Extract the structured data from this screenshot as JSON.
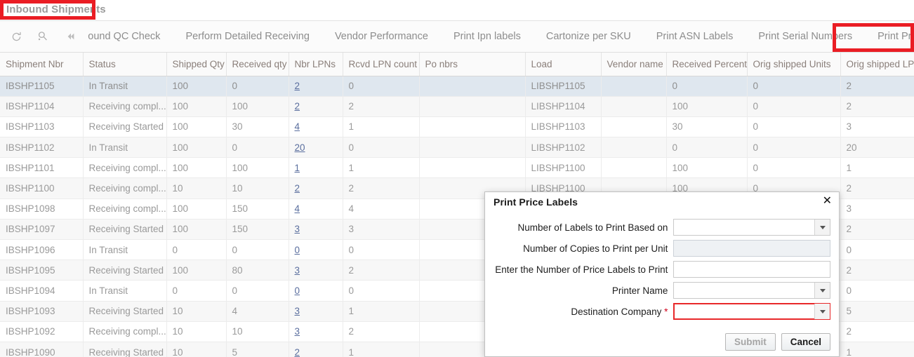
{
  "header": {
    "title": "Inbound Shipments"
  },
  "toolbar": {
    "icons": [
      {
        "name": "refresh-icon",
        "glyph": "refresh"
      },
      {
        "name": "search-icon",
        "glyph": "search"
      },
      {
        "name": "collapse-left-icon",
        "glyph": "double-chevron-left"
      }
    ],
    "items": [
      "ound QC Check",
      "Perform Detailed Receiving",
      "Vendor Performance",
      "Print Ipn labels",
      "Cartonize per SKU",
      "Print ASN Labels",
      "Print Serial Numbers",
      "Print Price Labels"
    ],
    "active_item": "Print Price Labels"
  },
  "grid": {
    "columns": [
      "Shipment Nbr",
      "Status",
      "Shipped Qty",
      "Received qty",
      "Nbr LPNs",
      "Rcvd LPN count",
      "Po nbrs",
      "Load",
      "Vendor name",
      "Received Percent",
      "Orig shipped Units",
      "Orig shipped LPN"
    ],
    "rows": [
      {
        "selected": true,
        "cells": [
          "IBSHP1105",
          "In Transit",
          "100",
          "0",
          "2",
          "0",
          "",
          "LIBSHP1105",
          "",
          "0",
          "0",
          "2"
        ]
      },
      {
        "selected": false,
        "cells": [
          "IBSHP1104",
          "Receiving compl...",
          "100",
          "100",
          "2",
          "2",
          "",
          "LIBSHP1104",
          "",
          "100",
          "0",
          "2"
        ]
      },
      {
        "selected": false,
        "cells": [
          "IBSHP1103",
          "Receiving Started",
          "100",
          "30",
          "4",
          "1",
          "",
          "LIBSHP1103",
          "",
          "30",
          "0",
          "3"
        ]
      },
      {
        "selected": false,
        "cells": [
          "IBSHP1102",
          "In Transit",
          "100",
          "0",
          "20",
          "0",
          "",
          "LIBSHP1102",
          "",
          "0",
          "0",
          "20"
        ]
      },
      {
        "selected": false,
        "cells": [
          "IBSHP1101",
          "Receiving compl...",
          "100",
          "100",
          "1",
          "1",
          "",
          "LIBSHP1100",
          "",
          "100",
          "0",
          "1"
        ]
      },
      {
        "selected": false,
        "cells": [
          "IBSHP1100",
          "Receiving compl...",
          "10",
          "10",
          "2",
          "2",
          "",
          "LIBSHP1100",
          "",
          "100",
          "0",
          "2"
        ]
      },
      {
        "selected": false,
        "cells": [
          "IBSHP1098",
          "Receiving compl...",
          "100",
          "150",
          "4",
          "4",
          "",
          "",
          "",
          "",
          "",
          "3"
        ]
      },
      {
        "selected": false,
        "cells": [
          "IBSHP1097",
          "Receiving Started",
          "100",
          "150",
          "3",
          "3",
          "",
          "",
          "",
          "",
          "",
          "2"
        ]
      },
      {
        "selected": false,
        "cells": [
          "IBSHP1096",
          "In Transit",
          "0",
          "0",
          "0",
          "0",
          "",
          "",
          "",
          "",
          "",
          "0"
        ]
      },
      {
        "selected": false,
        "cells": [
          "IBSHP1095",
          "Receiving Started",
          "100",
          "80",
          "3",
          "2",
          "",
          "",
          "",
          "",
          "",
          "2"
        ]
      },
      {
        "selected": false,
        "cells": [
          "IBSHP1094",
          "In Transit",
          "0",
          "0",
          "0",
          "0",
          "",
          "",
          "",
          "",
          "",
          "0"
        ]
      },
      {
        "selected": false,
        "cells": [
          "IBSHP1093",
          "Receiving Started",
          "10",
          "4",
          "3",
          "1",
          "",
          "",
          "",
          "",
          "",
          "5"
        ]
      },
      {
        "selected": false,
        "cells": [
          "IBSHP1092",
          "Receiving compl...",
          "10",
          "10",
          "3",
          "2",
          "",
          "",
          "",
          "",
          "",
          "2"
        ]
      },
      {
        "selected": false,
        "cells": [
          "IBSHP1090",
          "Receiving Started",
          "10",
          "5",
          "2",
          "1",
          "",
          "",
          "",
          "",
          "",
          "1"
        ]
      }
    ]
  },
  "dialog": {
    "title": "Print Price Labels",
    "close_label": "✕",
    "fields": [
      {
        "label": "Number of Labels to Print Based on",
        "value": "",
        "type": "select",
        "required": false,
        "error": false
      },
      {
        "label": "Number of Copies to Print per Unit",
        "value": "",
        "type": "readonly",
        "required": false,
        "error": false
      },
      {
        "label": "Enter the Number of Price Labels to Print",
        "value": "",
        "type": "text",
        "required": false,
        "error": false
      },
      {
        "label": "Printer Name",
        "value": "",
        "type": "select",
        "required": false,
        "error": false
      },
      {
        "label": "Destination Company",
        "value": "",
        "type": "select",
        "required": true,
        "error": true
      }
    ],
    "submit_label": "Submit",
    "submit_enabled": false,
    "cancel_label": "Cancel"
  },
  "colors": {
    "annotation": "#ea1d24",
    "selected_row": "#dfe7ef",
    "link": "#5a6e9e",
    "error": "#e8282a"
  }
}
